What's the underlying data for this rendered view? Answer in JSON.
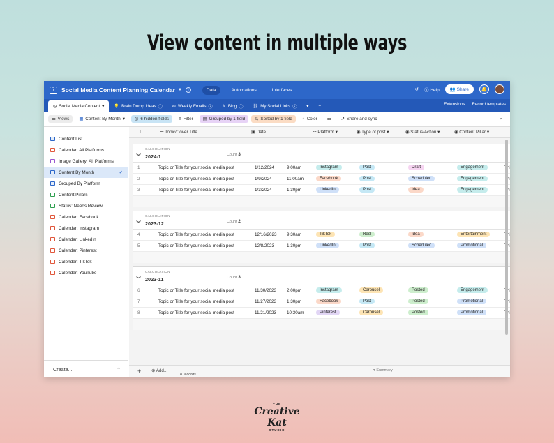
{
  "headline": "View content in multiple ways",
  "app": {
    "title": "Social Media Content Planning Calendar",
    "nav": [
      "Data",
      "Automations",
      "Interfaces"
    ],
    "help": "Help",
    "share": "Share"
  },
  "tabs": [
    "Social Media Content",
    "Brain Dump Ideas",
    "Weekly Emails",
    "Blog",
    "My Social Links"
  ],
  "tab_right": [
    "Extensions",
    "Record templates"
  ],
  "toolbar": {
    "views": "Views",
    "view_name": "Content By Month",
    "hidden": "6 hidden fields",
    "filter": "Filter",
    "grouped": "Grouped by 1 field",
    "sorted": "Sorted by 1 field",
    "color": "Color",
    "share_sync": "Share and sync"
  },
  "sidebar": {
    "items": [
      {
        "label": "Content List",
        "icon": "grid-icon",
        "color": "#2d67c9"
      },
      {
        "label": "Calendar: All Platforms",
        "icon": "calendar-icon",
        "color": "#e0573b"
      },
      {
        "label": "Image Gallery: All Platforms",
        "icon": "gallery-icon",
        "color": "#9b59d0"
      },
      {
        "label": "Content By Month",
        "icon": "grid-icon",
        "color": "#2d67c9"
      },
      {
        "label": "Grouped By Platform",
        "icon": "grid-icon",
        "color": "#2d67c9"
      },
      {
        "label": "Content Pillars",
        "icon": "kanban-icon",
        "color": "#2e9e4f"
      },
      {
        "label": "Status: Needs Review",
        "icon": "kanban-icon",
        "color": "#2e9e4f"
      },
      {
        "label": "Calendar: Facebook",
        "icon": "calendar-icon",
        "color": "#e0573b"
      },
      {
        "label": "Calendar: Instagram",
        "icon": "calendar-icon",
        "color": "#e0573b"
      },
      {
        "label": "Calendar: LinkedIn",
        "icon": "calendar-icon",
        "color": "#e0573b"
      },
      {
        "label": "Calendar: Pinterest",
        "icon": "calendar-icon",
        "color": "#e0573b"
      },
      {
        "label": "Calendar: TikTok",
        "icon": "calendar-icon",
        "color": "#e0573b"
      },
      {
        "label": "Calendar: YouTube",
        "icon": "calendar-icon",
        "color": "#e0573b"
      }
    ],
    "create": "Create..."
  },
  "columns": [
    "Topic/Cover Title",
    "Date",
    "Platform",
    "Type of post",
    "Status/Action",
    "Content Pillar"
  ],
  "group_calc_label": "CALCULATION",
  "count_label": "Count",
  "groups": [
    {
      "name": "2024-1",
      "count": "3",
      "rows": [
        {
          "n": "1",
          "title": "Topic or Title for your social media post",
          "date": "1/12/2024",
          "time": "9:00am",
          "platform": "Instagram",
          "type": "Post",
          "status": "Draft",
          "pillar": "Engagement",
          "extra": "This"
        },
        {
          "n": "2",
          "title": "Topic or Title for your social media post",
          "date": "1/9/2024",
          "time": "11:00am",
          "platform": "Facebook",
          "type": "Post",
          "status": "Scheduled",
          "pillar": "Engagement",
          "extra": "This"
        },
        {
          "n": "3",
          "title": "Topic or Title for your social media post",
          "date": "1/3/2024",
          "time": "1:30pm",
          "platform": "LinkedIn",
          "type": "Post",
          "status": "Idea",
          "pillar": "Engagement",
          "extra": "This"
        }
      ]
    },
    {
      "name": "2023-12",
      "count": "2",
      "rows": [
        {
          "n": "4",
          "title": "Topic or Title for your social media post",
          "date": "12/16/2023",
          "time": "9:30am",
          "platform": "TikTok",
          "type": "Reel",
          "status": "Idea",
          "pillar": "Entertainment",
          "extra": "This"
        },
        {
          "n": "5",
          "title": "Topic or Title for your social media post",
          "date": "12/8/2023",
          "time": "1:30pm",
          "platform": "LinkedIn",
          "type": "Post",
          "status": "Scheduled",
          "pillar": "Promotional",
          "extra": "This"
        }
      ]
    },
    {
      "name": "2023-11",
      "count": "3",
      "rows": [
        {
          "n": "6",
          "title": "Topic or Title for your social media post",
          "date": "11/30/2023",
          "time": "2:00pm",
          "platform": "Instagram",
          "type": "Carousel",
          "status": "Posted",
          "pillar": "Engagement",
          "extra": "This"
        },
        {
          "n": "7",
          "title": "Topic or Title for your social media post",
          "date": "11/27/2023",
          "time": "1:30pm",
          "platform": "Facebook",
          "type": "Post",
          "status": "Posted",
          "pillar": "Promotional",
          "extra": "This"
        },
        {
          "n": "8",
          "title": "Topic or Title for your social media post",
          "date": "11/21/2023",
          "time": "10:30am",
          "platform": "Pinterest",
          "type": "Carousel",
          "status": "Posted",
          "pillar": "Promotional",
          "extra": "This"
        }
      ]
    }
  ],
  "pill_colors": {
    "Instagram": "#c5ecec",
    "Facebook": "#fbd8c8",
    "LinkedIn": "#cfe0f8",
    "TikTok": "#fde4b4",
    "Pinterest": "#e2d6f5",
    "Post": "#c5e8f5",
    "Reel": "#cdeecd",
    "Carousel": "#fde4b4",
    "Draft": "#f6d4f1",
    "Scheduled": "#cfe0f8",
    "Idea": "#fbd8c8",
    "Posted": "#cdeecd",
    "Engagement": "#c5ecec",
    "Entertainment": "#fde4b4",
    "Promotional": "#cfe0f8"
  },
  "footer": {
    "add": "Add...",
    "records": "8 records",
    "summary": "Summary"
  },
  "logo": {
    "top": "THE",
    "brand": "Creative Kat",
    "bottom": "STUDIO"
  }
}
